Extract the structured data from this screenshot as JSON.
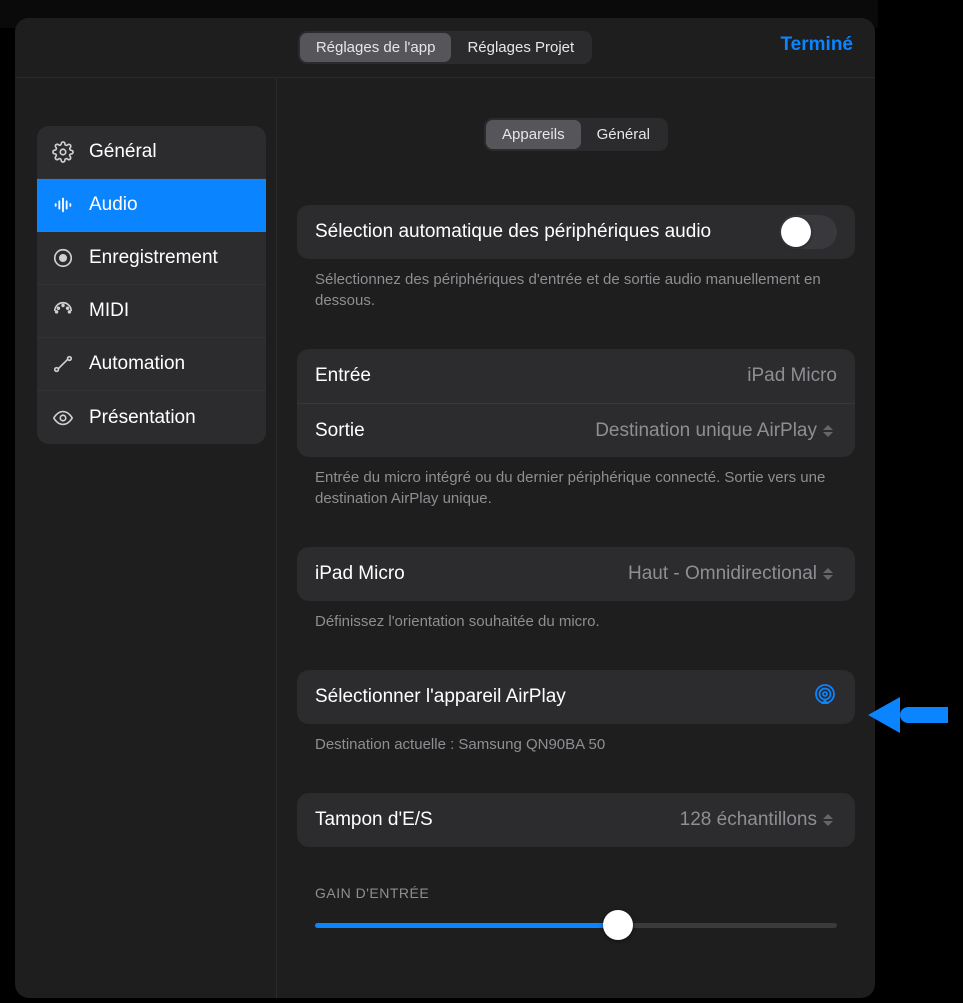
{
  "header": {
    "tabs": {
      "app": "Réglages de l'app",
      "project": "Réglages Projet"
    },
    "done": "Terminé"
  },
  "sidebar": {
    "items": [
      {
        "label": "Général"
      },
      {
        "label": "Audio"
      },
      {
        "label": "Enregistrement"
      },
      {
        "label": "MIDI"
      },
      {
        "label": "Automation"
      },
      {
        "label": "Présentation"
      }
    ]
  },
  "subtabs": {
    "devices": "Appareils",
    "general": "Général"
  },
  "auto_select": {
    "label": "Sélection automatique des périphériques audio",
    "help": "Sélectionnez des périphériques d'entrée et de sortie audio manuellement en dessous."
  },
  "io": {
    "input_label": "Entrée",
    "input_value": "iPad Micro",
    "output_label": "Sortie",
    "output_value": "Destination unique AirPlay",
    "help": "Entrée du micro intégré ou du dernier périphérique connecté. Sortie vers une destination AirPlay unique."
  },
  "mic": {
    "label": "iPad Micro",
    "value": "Haut - Omnidirectional",
    "help": "Définissez l'orientation souhaitée du micro."
  },
  "airplay": {
    "label": "Sélectionner l'appareil AirPlay",
    "help": "Destination actuelle : Samsung QN90BA 50"
  },
  "buffer": {
    "label": "Tampon d'E/S",
    "value": "128 échantillons"
  },
  "gain": {
    "header": "GAIN D'ENTRÉE"
  }
}
